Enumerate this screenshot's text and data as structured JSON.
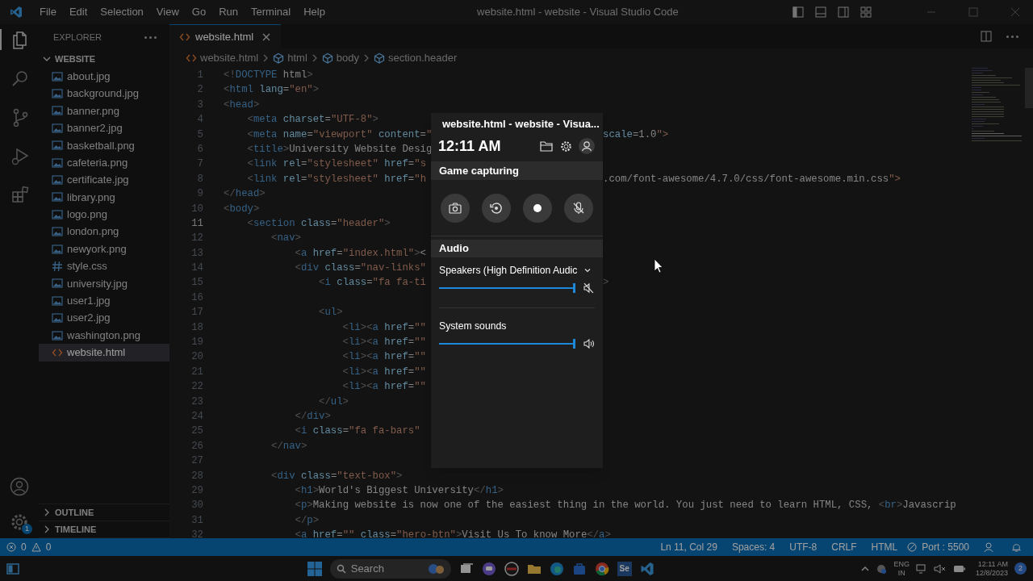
{
  "title_bar": {
    "menus": [
      "File",
      "Edit",
      "Selection",
      "View",
      "Go",
      "Run",
      "Terminal",
      "Help"
    ],
    "title": "website.html - website - Visual Studio Code"
  },
  "activity_bar": {
    "items": [
      {
        "kind": "explorer",
        "selected": true
      },
      {
        "kind": "search",
        "selected": false
      },
      {
        "kind": "source-control",
        "selected": false
      },
      {
        "kind": "run",
        "selected": false
      },
      {
        "kind": "extensions",
        "selected": false
      }
    ],
    "settings_badge": "1"
  },
  "sidebar": {
    "title": "EXPLORER",
    "folder": "WEBSITE",
    "files": [
      {
        "name": "about.jpg",
        "kind": "image",
        "selected": false
      },
      {
        "name": "background.jpg",
        "kind": "image",
        "selected": false
      },
      {
        "name": "banner.png",
        "kind": "image",
        "selected": false
      },
      {
        "name": "banner2.jpg",
        "kind": "image",
        "selected": false
      },
      {
        "name": "basketball.png",
        "kind": "image",
        "selected": false
      },
      {
        "name": "cafeteria.png",
        "kind": "image",
        "selected": false
      },
      {
        "name": "certificate.jpg",
        "kind": "image",
        "selected": false
      },
      {
        "name": "library.png",
        "kind": "image",
        "selected": false
      },
      {
        "name": "logo.png",
        "kind": "image",
        "selected": false
      },
      {
        "name": "london.png",
        "kind": "image",
        "selected": false
      },
      {
        "name": "newyork.png",
        "kind": "image",
        "selected": false
      },
      {
        "name": "style.css",
        "kind": "css",
        "selected": false
      },
      {
        "name": "university.jpg",
        "kind": "image",
        "selected": false
      },
      {
        "name": "user1.jpg",
        "kind": "image",
        "selected": false
      },
      {
        "name": "user2.jpg",
        "kind": "image",
        "selected": false
      },
      {
        "name": "washington.png",
        "kind": "image",
        "selected": false
      },
      {
        "name": "website.html",
        "kind": "html",
        "selected": true
      }
    ],
    "sections": [
      "OUTLINE",
      "TIMELINE"
    ]
  },
  "editor": {
    "tabs": [
      {
        "label": "website.html",
        "selected": true
      }
    ],
    "breadcrumb": [
      "website.html",
      "html",
      "body",
      "section.header"
    ],
    "lines": [
      {
        "number": "1",
        "text": "<!DOCTYPE html>",
        "current": false
      },
      {
        "number": "2",
        "text": "<html lang=\"en\">",
        "current": false
      },
      {
        "number": "3",
        "text": "<head>",
        "current": false
      },
      {
        "number": "4",
        "text": "    <meta charset=\"UTF-8\">",
        "current": false
      },
      {
        "number": "5",
        "text": "    <meta name=\"viewport\" content=\"",
        "right": "scale=1.0\">",
        "current": false
      },
      {
        "number": "6",
        "text": "    <title>University Website Desig",
        "current": false
      },
      {
        "number": "7",
        "text": "    <link rel=\"stylesheet\" href=\"s",
        "current": false
      },
      {
        "number": "8",
        "text": "    <link rel=\"stylesheet\" href=\"h",
        "right": ".com/font-awesome/4.7.0/css/font-awesome.min.css\">",
        "current": false
      },
      {
        "number": "9",
        "text": "</head>",
        "current": false
      },
      {
        "number": "10",
        "text": "<body>",
        "current": false
      },
      {
        "number": "11",
        "text": "    <section class=\"header\">",
        "current": true
      },
      {
        "number": "12",
        "text": "        <nav>",
        "current": false
      },
      {
        "number": "13",
        "text": "            <a href=\"index.html\"><",
        "current": false
      },
      {
        "number": "14",
        "text": "            <div class=\"nav-links\"",
        "current": false
      },
      {
        "number": "15",
        "text": "                <i class=\"fa fa-ti",
        "right": ">",
        "current": false
      },
      {
        "number": "16",
        "current": false
      },
      {
        "number": "17",
        "text": "                <ul>",
        "current": false
      },
      {
        "number": "18",
        "text": "                    <li><a href=\"\"",
        "current": false
      },
      {
        "number": "19",
        "text": "                    <li><a href=\"\"",
        "current": false
      },
      {
        "number": "20",
        "text": "                    <li><a href=\"\"",
        "current": false
      },
      {
        "number": "21",
        "text": "                    <li><a href=\"\"",
        "current": false
      },
      {
        "number": "22",
        "text": "                    <li><a href=\"\"",
        "current": false
      },
      {
        "number": "23",
        "text": "                </ul>",
        "current": false
      },
      {
        "number": "24",
        "text": "            </div>",
        "current": false
      },
      {
        "number": "25",
        "text": "            <i class=\"fa fa-bars\"",
        "current": false
      },
      {
        "number": "26",
        "text": "        </nav>",
        "current": false
      },
      {
        "number": "27",
        "current": false
      },
      {
        "number": "28",
        "text": "        <div class=\"text-box\">",
        "current": false
      },
      {
        "number": "29",
        "text": "            <h1>World's Biggest University</h1>",
        "current": false
      },
      {
        "number": "30",
        "text": "            <p>Making website is now one of the easiest thing in the world. You just need to learn HTML, CSS, <br>Javascrip",
        "current": false
      },
      {
        "number": "31",
        "text": "            </p>",
        "current": false
      },
      {
        "number": "32",
        "text": "            <a href=\"\" class=\"hero-btn\">Visit Us To know More</a>",
        "current": false
      }
    ]
  },
  "game_bar": {
    "title": "website.html - website - Visua...",
    "time": "12:11 AM",
    "capture": {
      "title": "Game capturing",
      "buttons": [
        {
          "kind": "screenshot"
        },
        {
          "kind": "replay"
        },
        {
          "kind": "record"
        },
        {
          "kind": "mic",
          "muted": true
        }
      ]
    },
    "audio": {
      "title": "Audio",
      "channels": [
        {
          "name": "Speakers (High Definition Audic",
          "kind": "device",
          "level": 1.0,
          "muted": true
        },
        {
          "name": "System sounds",
          "kind": "app",
          "level": 1.0,
          "muted": false
        }
      ]
    }
  },
  "status_bar": {
    "errors": "0",
    "warnings": "0",
    "items": [
      "Ln 11, Col 29",
      "Spaces: 4",
      "UTF-8",
      "CRLF",
      "HTML"
    ],
    "port": "Port : 5500"
  },
  "taskbar": {
    "search": {
      "placeholder": "Search"
    },
    "apps": [
      {
        "kind": "taskview"
      },
      {
        "kind": "chat"
      },
      {
        "kind": "media"
      },
      {
        "kind": "folder"
      },
      {
        "kind": "edge"
      },
      {
        "kind": "store"
      },
      {
        "kind": "chrome"
      },
      {
        "kind": "tile",
        "label": "Se"
      },
      {
        "kind": "vscode"
      }
    ],
    "language": "ENG",
    "region": "IN",
    "time": "12:11 AM",
    "date": "12/8/2023",
    "notifications": "2"
  }
}
